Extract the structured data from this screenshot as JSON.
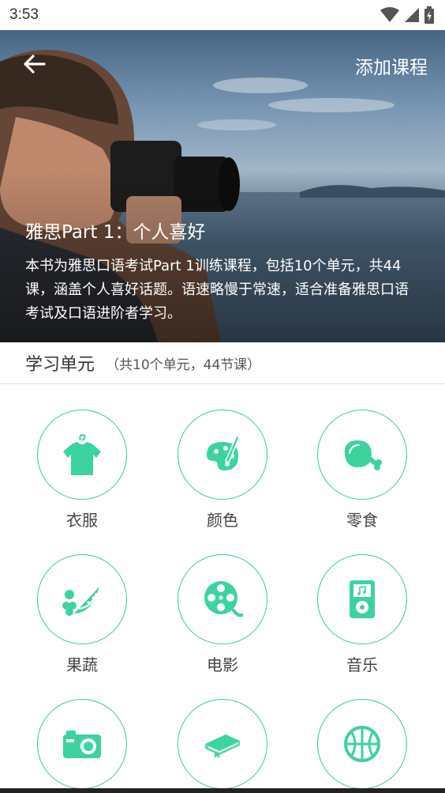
{
  "status_bar": {
    "time": "3:53"
  },
  "header": {
    "back_icon": "arrow-left-icon",
    "add_course_label": "添加课程"
  },
  "course": {
    "title": "雅思Part 1：个人喜好",
    "description": "本书为雅思口语考试Part 1训练课程，包括10个单元，共44课，涵盖个人喜好话题。语速略慢于常速，适合准备雅思口语考试及口语进阶者学习。"
  },
  "units_section": {
    "title": "学习单元",
    "count_text": "（共10个单元，44节课）"
  },
  "units": [
    {
      "label": "衣服",
      "icon": "tshirt-icon"
    },
    {
      "label": "颜色",
      "icon": "palette-icon"
    },
    {
      "label": "零食",
      "icon": "chicken-leg-icon"
    },
    {
      "label": "果蔬",
      "icon": "watermelon-icon"
    },
    {
      "label": "电影",
      "icon": "film-reel-icon"
    },
    {
      "label": "音乐",
      "icon": "music-player-icon"
    },
    {
      "label": "",
      "icon": "camera-icon"
    },
    {
      "label": "",
      "icon": "book-icon"
    },
    {
      "label": "",
      "icon": "basketball-icon"
    }
  ],
  "colors": {
    "accent": "#3ec79a",
    "icon_fill": "#3dd39e"
  }
}
